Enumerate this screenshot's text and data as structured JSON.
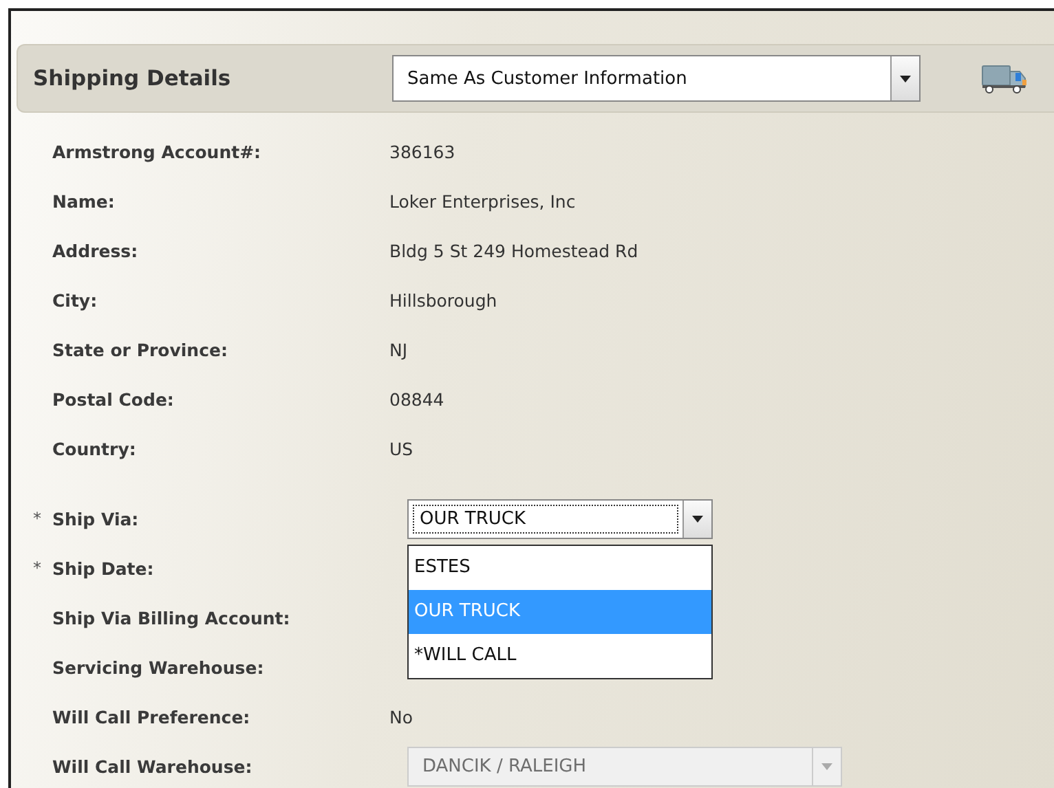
{
  "header": {
    "title": "Shipping Details",
    "address_source": "Same As Customer Information"
  },
  "fields": [
    {
      "label": "Armstrong Account#:",
      "kind": "text",
      "value": "386163"
    },
    {
      "label": "Name:",
      "kind": "text",
      "value": "Loker Enterprises, Inc"
    },
    {
      "label": "Address:",
      "kind": "text",
      "value": "Bldg 5 St 249 Homestead Rd"
    },
    {
      "label": "City:",
      "kind": "text",
      "value": "Hillsborough"
    },
    {
      "label": "State or Province:",
      "kind": "text",
      "value": "NJ"
    },
    {
      "label": "Postal Code:",
      "kind": "text",
      "value": "08844"
    },
    {
      "label": "Country:",
      "kind": "text",
      "value": "US"
    },
    {
      "label": "Ship Via:",
      "kind": "select",
      "marker": "*",
      "value": "OUR TRUCK",
      "disabled": false,
      "expanded": true,
      "options": [
        {
          "label": "ESTES",
          "selected": false
        },
        {
          "label": "OUR TRUCK",
          "selected": true
        },
        {
          "label": "*WILL CALL",
          "selected": false
        }
      ]
    },
    {
      "label": "Ship Date:",
      "kind": "blank",
      "marker": "*"
    },
    {
      "label": "Ship Via Billing Account:",
      "kind": "blank"
    },
    {
      "label": "Servicing Warehouse:",
      "kind": "blank"
    },
    {
      "label": "Will Call Preference:",
      "kind": "text",
      "value": "No"
    },
    {
      "label": "Will Call Warehouse:",
      "kind": "select",
      "value": "DANCIK / RALEIGH",
      "disabled": true,
      "expanded": false
    }
  ]
}
